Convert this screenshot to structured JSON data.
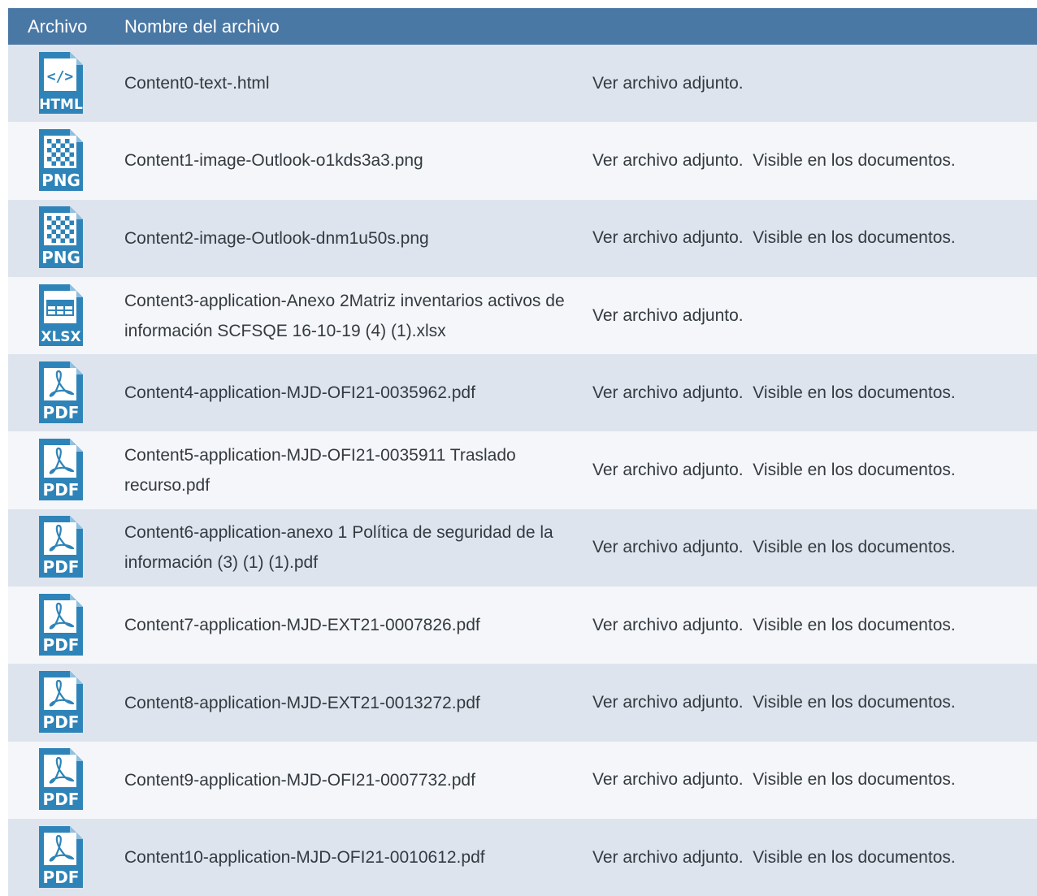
{
  "header": {
    "col_archivo": "Archivo",
    "col_nombre": "Nombre del archivo"
  },
  "colors": {
    "header_bg": "#4a78a5",
    "icon_blue": "#2e84b8",
    "row_odd": "#dee4ed",
    "row_even": "#f5f6f9"
  },
  "rows": [
    {
      "type": "HTML",
      "icon": "html-file-icon",
      "name": "Content0-text-.html",
      "desc": "Ver archivo adjunto."
    },
    {
      "type": "PNG",
      "icon": "png-file-icon",
      "name": "Content1-image-Outlook-o1kds3a3.png",
      "desc": "Ver archivo adjunto.  Visible en los documentos."
    },
    {
      "type": "PNG",
      "icon": "png-file-icon",
      "name": "Content2-image-Outlook-dnm1u50s.png",
      "desc": "Ver archivo adjunto.  Visible en los documentos."
    },
    {
      "type": "XLSX",
      "icon": "xlsx-file-icon",
      "name": "Content3-application-Anexo 2Matriz inventarios activos de información SCFSQE 16-10-19 (4) (1).xlsx",
      "desc": "Ver archivo adjunto."
    },
    {
      "type": "PDF",
      "icon": "pdf-file-icon",
      "name": "Content4-application-MJD-OFI21-0035962.pdf",
      "desc": "Ver archivo adjunto.  Visible en los documentos."
    },
    {
      "type": "PDF",
      "icon": "pdf-file-icon",
      "name": "Content5-application-MJD-OFI21-0035911 Traslado recurso.pdf",
      "desc": "Ver archivo adjunto.  Visible en los documentos."
    },
    {
      "type": "PDF",
      "icon": "pdf-file-icon",
      "name": "Content6-application-anexo 1 Política de seguridad de la información (3) (1) (1).pdf",
      "desc": "Ver archivo adjunto.  Visible en los documentos."
    },
    {
      "type": "PDF",
      "icon": "pdf-file-icon",
      "name": "Content7-application-MJD-EXT21-0007826.pdf",
      "desc": "Ver archivo adjunto.  Visible en los documentos."
    },
    {
      "type": "PDF",
      "icon": "pdf-file-icon",
      "name": "Content8-application-MJD-EXT21-0013272.pdf",
      "desc": "Ver archivo adjunto.  Visible en los documentos."
    },
    {
      "type": "PDF",
      "icon": "pdf-file-icon",
      "name": "Content9-application-MJD-OFI21-0007732.pdf",
      "desc": "Ver archivo adjunto.  Visible en los documentos."
    },
    {
      "type": "PDF",
      "icon": "pdf-file-icon",
      "name": "Content10-application-MJD-OFI21-0010612.pdf",
      "desc": "Ver archivo adjunto.  Visible en los documentos."
    }
  ]
}
